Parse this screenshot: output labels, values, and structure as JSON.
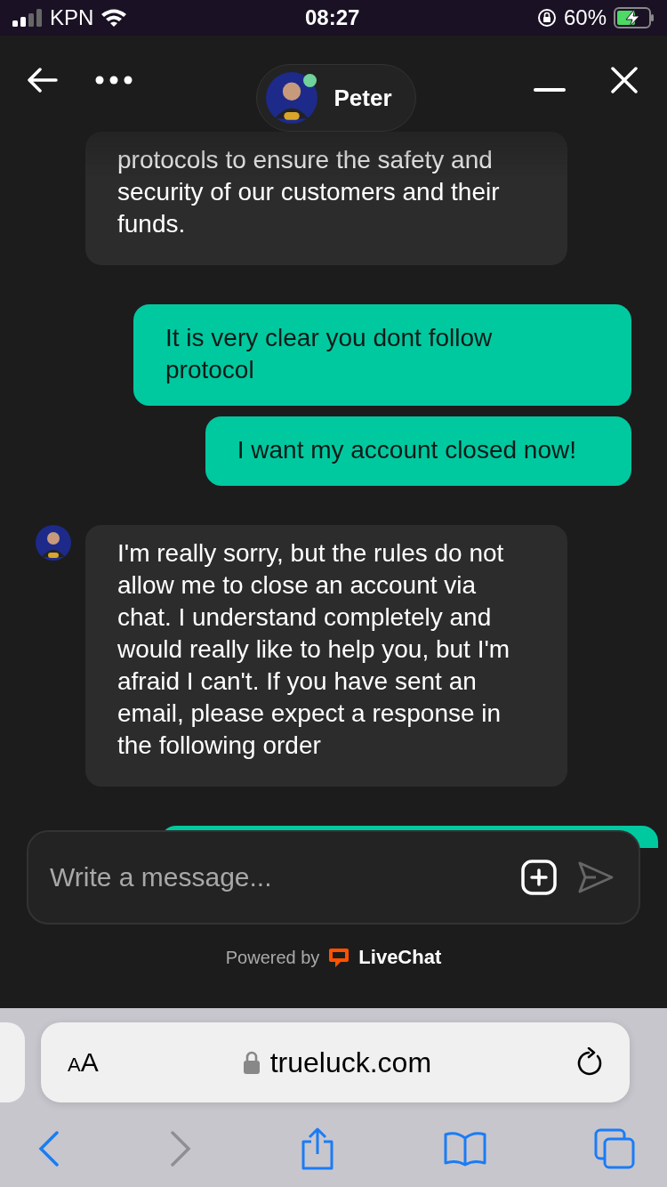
{
  "status_bar": {
    "carrier": "KPN",
    "time": "08:27",
    "battery": "60%",
    "charging": true
  },
  "header": {
    "agent_name": "Peter",
    "online": true
  },
  "messages": [
    {
      "kind": "agent",
      "avatar": false,
      "faded_top": true,
      "text": "protocols to ensure the safety and security of our customers and their funds."
    },
    {
      "kind": "visitor",
      "text": "It is very clear you dont follow protocol"
    },
    {
      "kind": "visitor",
      "text": "I want my account closed now!"
    },
    {
      "kind": "agent",
      "avatar": true,
      "faded_top": false,
      "text": "I'm really sorry, but the rules do not allow me to close an account via chat. I understand completely and would really like to help you, but I'm afraid I can't. If you have sent an email, please expect a response in the following order"
    },
    {
      "kind": "visitor"
    }
  ],
  "composer": {
    "placeholder": "Write a message..."
  },
  "footer": {
    "powered_by": "Powered by",
    "brand": "LiveChat"
  },
  "browser": {
    "text_size": "AA",
    "url": "trueluck.com",
    "toolbar": [
      {
        "kind": "back",
        "disabled": false
      },
      {
        "kind": "forward",
        "disabled": true
      },
      {
        "kind": "share",
        "disabled": false
      },
      {
        "kind": "bookmarks",
        "disabled": false
      },
      {
        "kind": "tabs",
        "disabled": false
      }
    ]
  }
}
